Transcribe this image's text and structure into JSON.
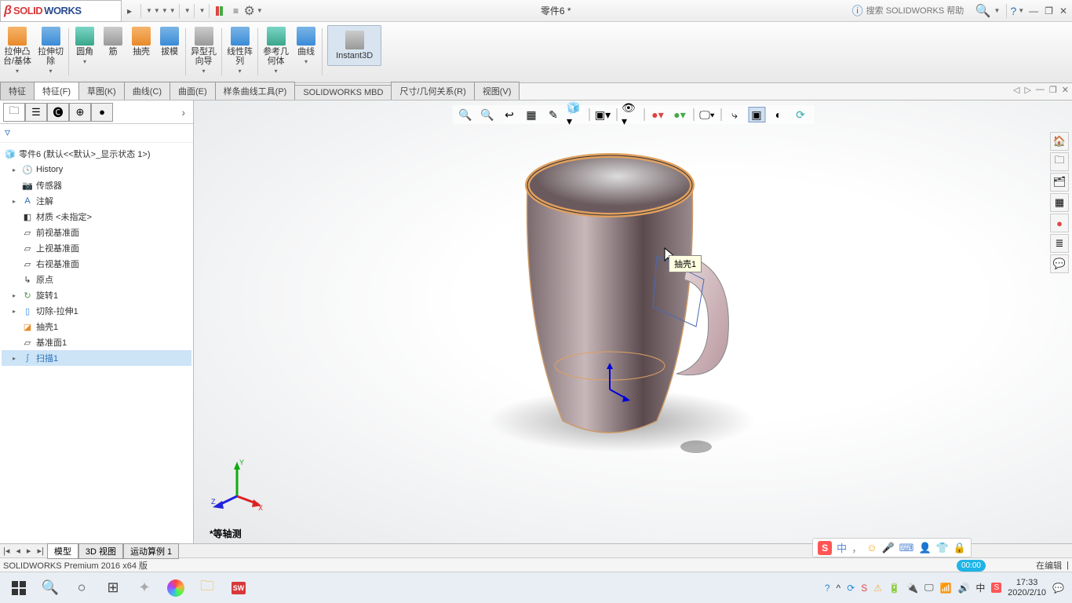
{
  "app": {
    "name_solid": "SOLID",
    "name_works": "WORKS",
    "ds": "DS"
  },
  "document_title": "零件6 *",
  "search": {
    "placeholder": "搜索 SOLIDWORKS 帮助"
  },
  "ribbon": {
    "extrude_boss": "拉伸凸\n台/基体",
    "extrude_cut": "拉伸切\n除",
    "fillet": "圆角",
    "rib": "筋",
    "shell": "抽壳",
    "draft": "拔模",
    "hole_wizard": "异型孔\n向导",
    "linear_pattern": "线性阵\n列",
    "ref_geom": "参考几\n何体",
    "curves": "曲线",
    "instant3d": "Instant3D"
  },
  "tabs": {
    "pre": "特征",
    "features": "特征(F)",
    "sketch": "草图(K)",
    "curves": "曲线(C)",
    "surfaces": "曲面(E)",
    "spline_tools": "样条曲线工具(P)",
    "mbd": "SOLIDWORKS MBD",
    "dim_rel": "尺寸/几何关系(R)",
    "view": "视图(V)"
  },
  "tree": {
    "root": "零件6  (默认<<默认>_显示状态 1>)",
    "history": "History",
    "sensors": "传感器",
    "annotations": "注解",
    "material": "材质 <未指定>",
    "front_plane": "前视基准面",
    "top_plane": "上视基准面",
    "right_plane": "右视基准面",
    "origin": "原点",
    "revolve1": "旋转1",
    "cut_extrude1": "切除-拉伸1",
    "shell1": "抽壳1",
    "plane1": "基准面1",
    "sweep1": "扫描1"
  },
  "tooltip": "抽壳1",
  "view_label": "*等轴测",
  "bottom_tabs": {
    "model": "模型",
    "view3d": "3D 视图",
    "motion1": "运动算例 1"
  },
  "status": {
    "version": "SOLIDWORKS Premium 2016 x64 版",
    "editing": "在编辑"
  },
  "rec_time": "00:00",
  "ime": {
    "zhong": "中",
    "punct": "，",
    "smile": "☺",
    "mic": "🎤",
    "kb": "⌨",
    "person": "👤",
    "shirt": "👕",
    "lock": "🔒"
  },
  "clock": {
    "time": "17:33",
    "date": "2020/2/10"
  },
  "tray": {
    "help": "?",
    "up": "^"
  }
}
